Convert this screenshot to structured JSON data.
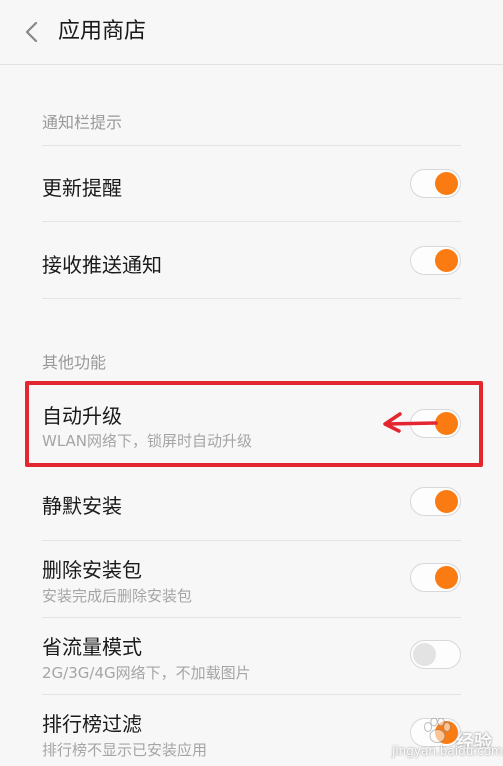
{
  "header": {
    "title": "应用商店",
    "back_icon": "chevron-left-icon"
  },
  "sections": {
    "notification": {
      "title": "通知栏提示"
    },
    "other": {
      "title": "其他功能"
    }
  },
  "settings": {
    "update_reminder": {
      "label": "更新提醒",
      "enabled": true
    },
    "push_notifications": {
      "label": "接收推送通知",
      "enabled": true
    },
    "auto_upgrade": {
      "label": "自动升级",
      "description": "WLAN网络下，锁屏时自动升级",
      "enabled": true
    },
    "silent_install": {
      "label": "静默安装",
      "enabled": true
    },
    "delete_package": {
      "label": "删除安装包",
      "description": "安装完成后删除安装包",
      "enabled": true
    },
    "data_saver": {
      "label": "省流量模式",
      "description": "2G/3G/4G网络下，不加载图片",
      "enabled": false
    },
    "ranking_filter": {
      "label": "排行榜过滤",
      "description": "排行榜不显示已安装应用",
      "enabled": true
    }
  },
  "annotation": {
    "color": "#e3262f"
  },
  "watermark": {
    "cn": "经验",
    "en": "jingyan.baidu.com"
  },
  "colors": {
    "accent": "#f97b12",
    "toggle_off": "#e3e3e3",
    "background": "#f7f7f7"
  }
}
